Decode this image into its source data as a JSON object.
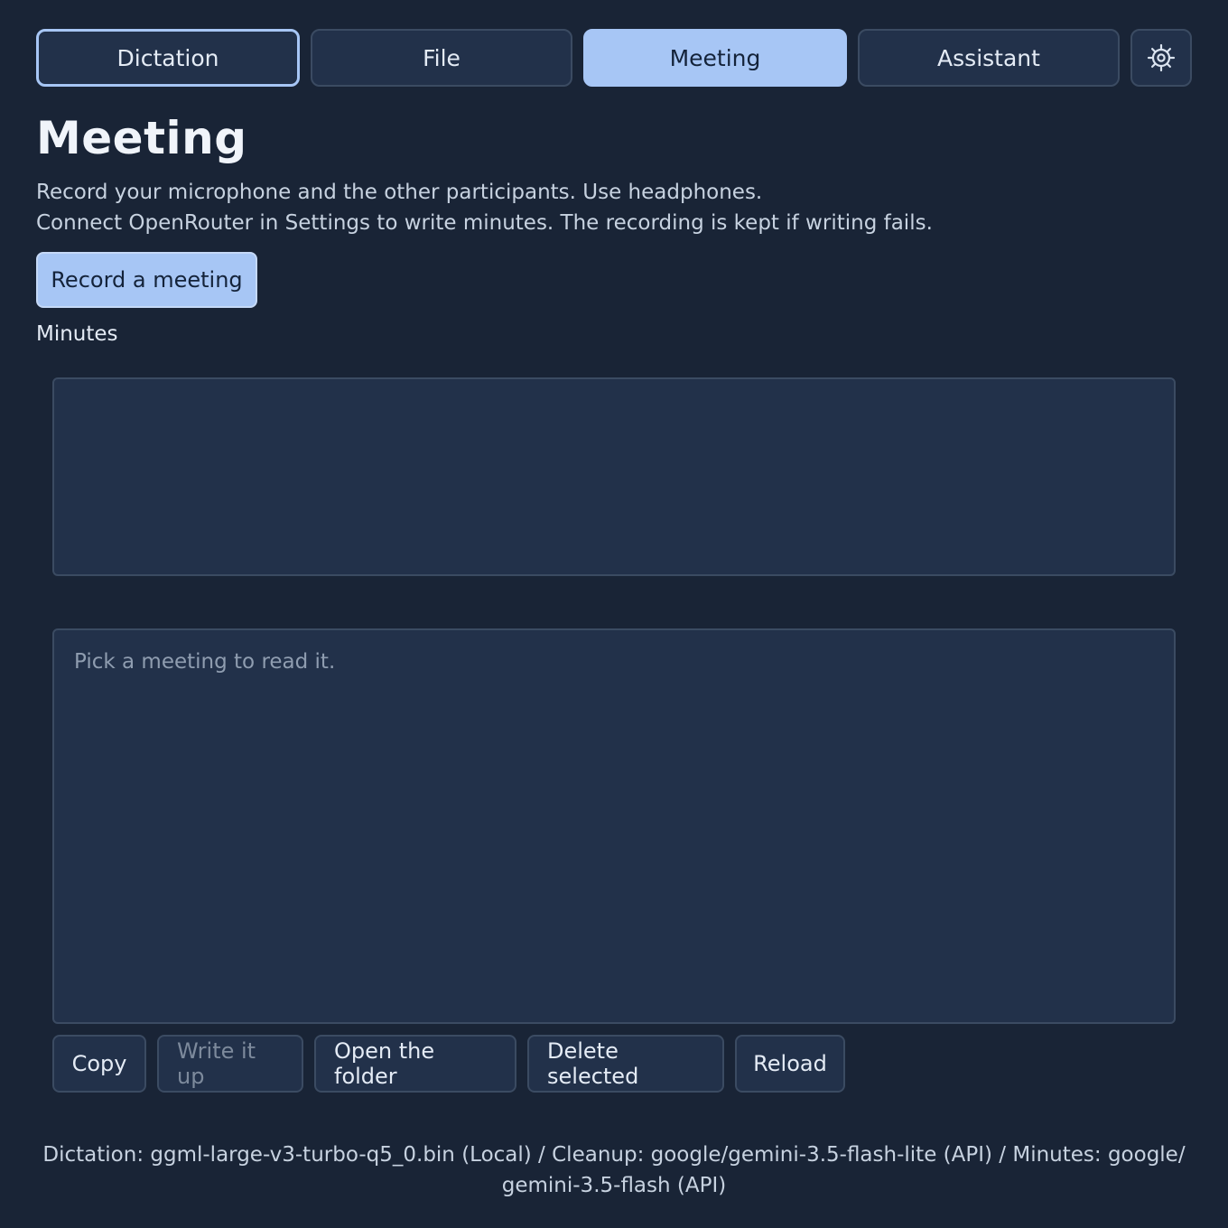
{
  "tabs": [
    {
      "label": "Dictation",
      "state": "focused"
    },
    {
      "label": "File",
      "state": "normal"
    },
    {
      "label": "Meeting",
      "state": "active"
    },
    {
      "label": "Assistant",
      "state": "normal"
    }
  ],
  "settings_icon": "gear-icon",
  "page": {
    "title": "Meeting",
    "description_line1": "Record your microphone and the other participants. Use headphones.",
    "description_line2": "Connect OpenRouter in Settings to write minutes. The recording is kept if writing fails.",
    "record_button": "Record a meeting",
    "minutes_label": "Minutes",
    "reader_placeholder": "Pick a meeting to read it."
  },
  "actions": {
    "copy": "Copy",
    "write_up": "Write it up",
    "open_folder": "Open the folder",
    "delete_selected": "Delete selected",
    "reload": "Reload"
  },
  "footer": {
    "line1": "Dictation: ggml-large-v3-turbo-q5_0.bin (Local) / Cleanup: google/gemini-3.5-flash-lite (API) / Minutes: google/",
    "line2": "gemini-3.5-flash (API)"
  },
  "colors": {
    "background": "#192436",
    "surface": "#22314a",
    "accent": "#a7c6f5",
    "border": "#3b4b62"
  }
}
